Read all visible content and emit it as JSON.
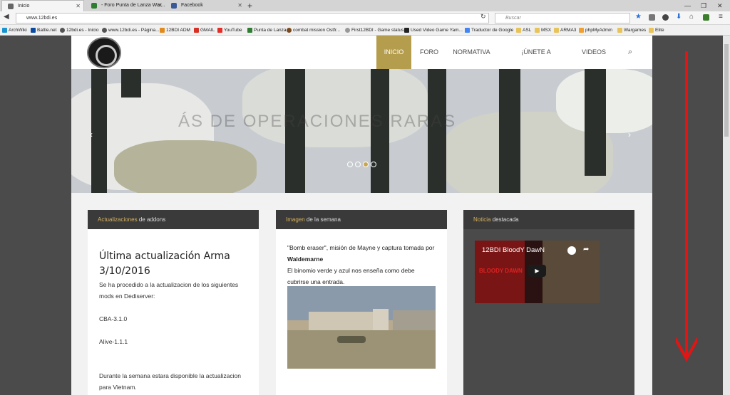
{
  "browser": {
    "tabs": [
      {
        "title": "Inicio",
        "color": "#666666"
      },
      {
        "title": "- Foro Punta de Lanza War...",
        "color": "#2e7d32"
      },
      {
        "title": "Facebook",
        "color": "#3b5998"
      }
    ],
    "url": "www.12bdi.es",
    "search_placeholder": "Buscar",
    "bookmarks": [
      "ArchWiki",
      "Battle.net",
      "12bdi.es - Inicio",
      "www.12bdi.es - Página...",
      "12BDI ADM",
      "GMAIL",
      "YouTube",
      "Punta de Lanza",
      "combat mission Ostfr...",
      "First12BDI - Game status",
      "Used Video Game Yam...",
      "Traductor de Google",
      "ASL",
      "MSX",
      "ARMA3",
      "phpMyAdmin",
      "Wargames",
      "Elite"
    ]
  },
  "site": {
    "menu": [
      "INICIO",
      "FORO",
      "NORMATIVA",
      "¡ÚNETE A NOSOTROS!",
      "VIDEOS"
    ],
    "hero_text": "ÁS DE OPERACIONES RARAS",
    "columns": [
      {
        "head_highlight": "Actualizaciones",
        "head_rest": "de addons"
      },
      {
        "head_highlight": "Imagen",
        "head_rest": "de la semana"
      },
      {
        "head_highlight": "Noticia",
        "head_rest": "destacada"
      }
    ],
    "update": {
      "title": "Última actualización Arma 3/10/2016",
      "p1": "Se ha procedido a la actualizacion de los siguientes mods en Dediserver:",
      "mod1": "CBA-3.1.0",
      "mod2": "Alive-1.1.1",
      "p2": "Durante la semana estara disponible la actualizacion para Vietnam."
    },
    "image": {
      "caption1": "\"Bomb eraser\", misión de Mayne y captura tomada por",
      "author": "Waldemarne",
      "caption2": "El binomio verde y azul nos enseña como debe cubrirse una entrada."
    },
    "video": {
      "title": "12BDI BloodY DawN",
      "overlay": "BLOODY DAWN"
    }
  }
}
